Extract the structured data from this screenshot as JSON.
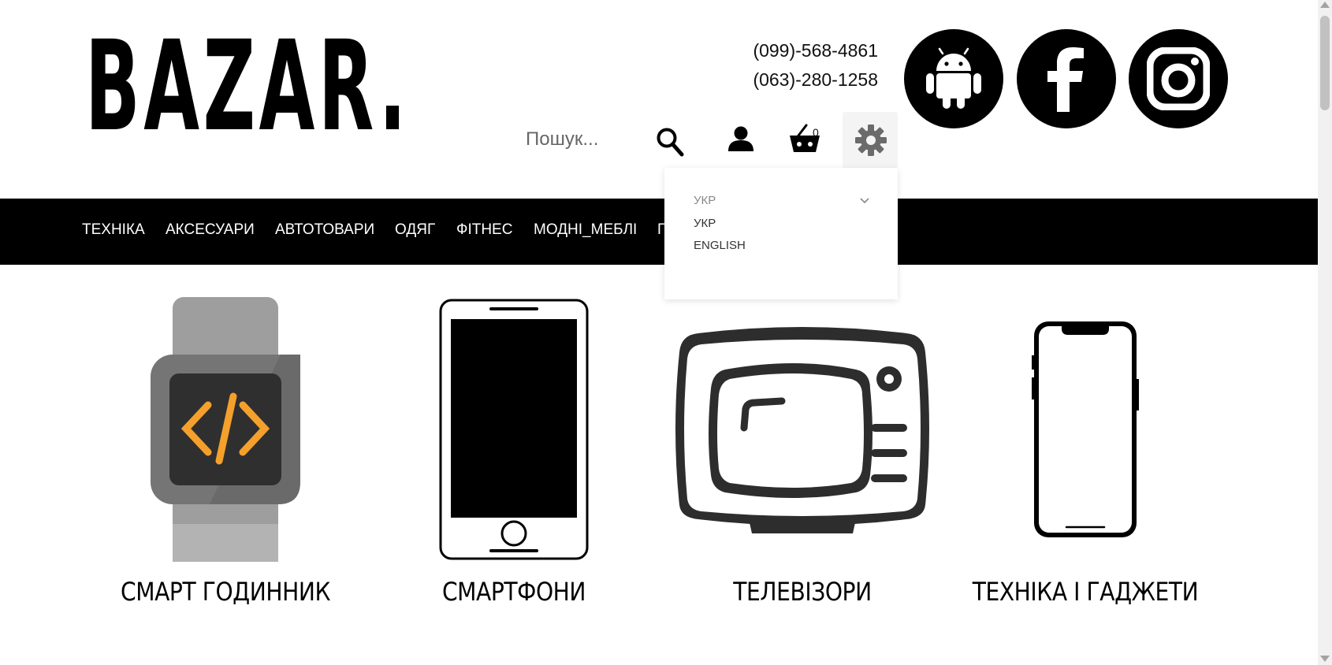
{
  "header": {
    "logo_text": "BAZAR.",
    "phones": [
      "(099)-568-4861",
      "(063)-280-1258"
    ],
    "social": [
      {
        "name": "android",
        "icon": "android-icon"
      },
      {
        "name": "facebook",
        "icon": "facebook-icon"
      },
      {
        "name": "instagram",
        "icon": "instagram-icon"
      }
    ],
    "search_placeholder": "Пошук...",
    "cart_count": "0"
  },
  "nav": {
    "items": [
      "ТЕХНІКА",
      "АКСЕСУАРИ",
      "АВТОТОВАРИ",
      "ОДЯГ",
      "ФІТНЕС",
      "МОДНІ_МЕБЛІ",
      "П"
    ]
  },
  "language_dropdown": {
    "current": "УКР",
    "options": [
      "УКР",
      "ENGLISH"
    ]
  },
  "categories": [
    {
      "label": "СМАРТ ГОДИННИК",
      "icon": "smartwatch-icon"
    },
    {
      "label": "СМАРТФОНИ",
      "icon": "smartphone-icon"
    },
    {
      "label": "ТЕЛЕВІЗОРИ",
      "icon": "tv-icon"
    },
    {
      "label": "ТЕХНІКА І ГАДЖЕТИ",
      "icon": "iphone-icon"
    }
  ],
  "colors": {
    "primary": "#000000",
    "background": "#ffffff",
    "watch_accent": "#f5a02c"
  }
}
